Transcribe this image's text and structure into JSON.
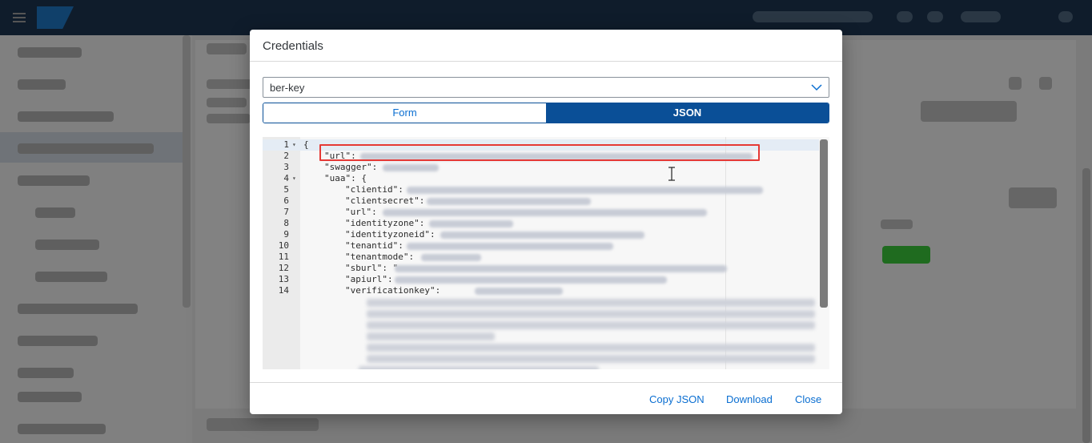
{
  "dialog": {
    "title": "Credentials",
    "select": {
      "value": "ber-key"
    },
    "tabs": [
      {
        "label": "Form",
        "selected": false
      },
      {
        "label": "JSON",
        "selected": true
      }
    ],
    "editor": {
      "lines": [
        {
          "n": "1",
          "text": "{",
          "fold": true
        },
        {
          "n": "2",
          "text": "\"url\":"
        },
        {
          "n": "3",
          "text": "\"swagger\":"
        },
        {
          "n": "4",
          "text": "\"uaa\": {",
          "fold": true
        },
        {
          "n": "5",
          "text": "\"clientid\":"
        },
        {
          "n": "6",
          "text": "\"clientsecret\":"
        },
        {
          "n": "7",
          "text": "\"url\":"
        },
        {
          "n": "8",
          "text": "\"identityzone\":"
        },
        {
          "n": "9",
          "text": "\"identityzoneid\":"
        },
        {
          "n": "10",
          "text": "\"tenantid\":"
        },
        {
          "n": "11",
          "text": "\"tenantmode\":"
        },
        {
          "n": "12",
          "text": "\"sburl\": \""
        },
        {
          "n": "13",
          "text": "\"apiurl\":"
        },
        {
          "n": "14",
          "text": "\"verificationkey\":"
        }
      ]
    },
    "footer": {
      "copy_json": "Copy JSON",
      "download": "Download",
      "close": "Close"
    }
  },
  "colors": {
    "accent": "#0a6ed1",
    "selected_tab": "#0a4f97",
    "highlight": "#e53935"
  }
}
